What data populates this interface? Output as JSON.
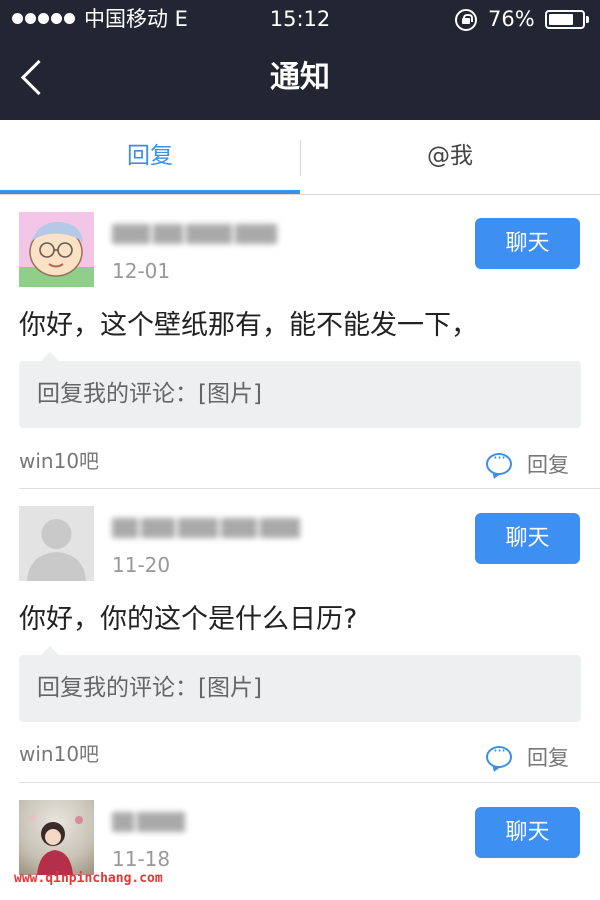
{
  "status_bar": {
    "carrier": "中国移动  E",
    "time": "15:12",
    "battery_pct_label": "76%",
    "battery_level": 0.76
  },
  "nav": {
    "title": "通知"
  },
  "tabs": [
    {
      "label": "回复",
      "active": true
    },
    {
      "label": "@我",
      "active": false
    }
  ],
  "notifications": [
    {
      "date": "12-01",
      "chat_label": "聊天",
      "message": "你好，这个壁纸那有，能不能发一下，",
      "quote": "回复我的评论：[图片]",
      "forum": "win10吧",
      "reply_label": "回复"
    },
    {
      "date": "11-20",
      "chat_label": "聊天",
      "message": "你好，你的这个是什么日历?",
      "quote": "回复我的评论：[图片]",
      "forum": "win10吧",
      "reply_label": "回复"
    },
    {
      "date": "11-18",
      "chat_label": "聊天"
    }
  ],
  "watermark": "www.qinpinchang.com"
}
